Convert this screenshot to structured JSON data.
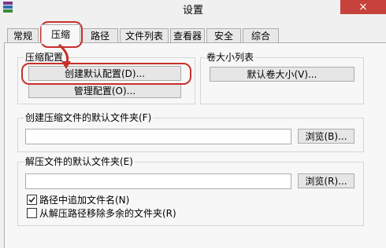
{
  "window": {
    "title": "设置",
    "close_glyph": "×"
  },
  "tabs": [
    {
      "label": "常规"
    },
    {
      "label": "压缩",
      "active": true
    },
    {
      "label": "路径"
    },
    {
      "label": "文件列表"
    },
    {
      "label": "查看器"
    },
    {
      "label": "安全"
    },
    {
      "label": "综合"
    }
  ],
  "compression_profiles": {
    "label": "压缩配置",
    "create_default_button": "创建默认配置(D)...",
    "manage_button": "管理配置(O)..."
  },
  "volume_sizes": {
    "label": "卷大小列表",
    "default_sizes_button": "默认卷大小(V)..."
  },
  "archive_folder": {
    "label": "创建压缩文件的默认文件夹(F)",
    "value": "",
    "browse_button": "浏览(B)..."
  },
  "extract_folder": {
    "label": "解压文件的默认文件夹(E)",
    "value": "",
    "browse_button": "浏览(R)...",
    "options": [
      {
        "label": "路径中追加文件名(N)",
        "checked": true
      },
      {
        "label": "从解压路径移除多余的文件夹(R)",
        "checked": false
      }
    ]
  },
  "colors": {
    "highlight": "#c9302c",
    "close": "#c7423a"
  },
  "icons": {
    "app": "winrar-books-icon",
    "check": "check-icon"
  }
}
